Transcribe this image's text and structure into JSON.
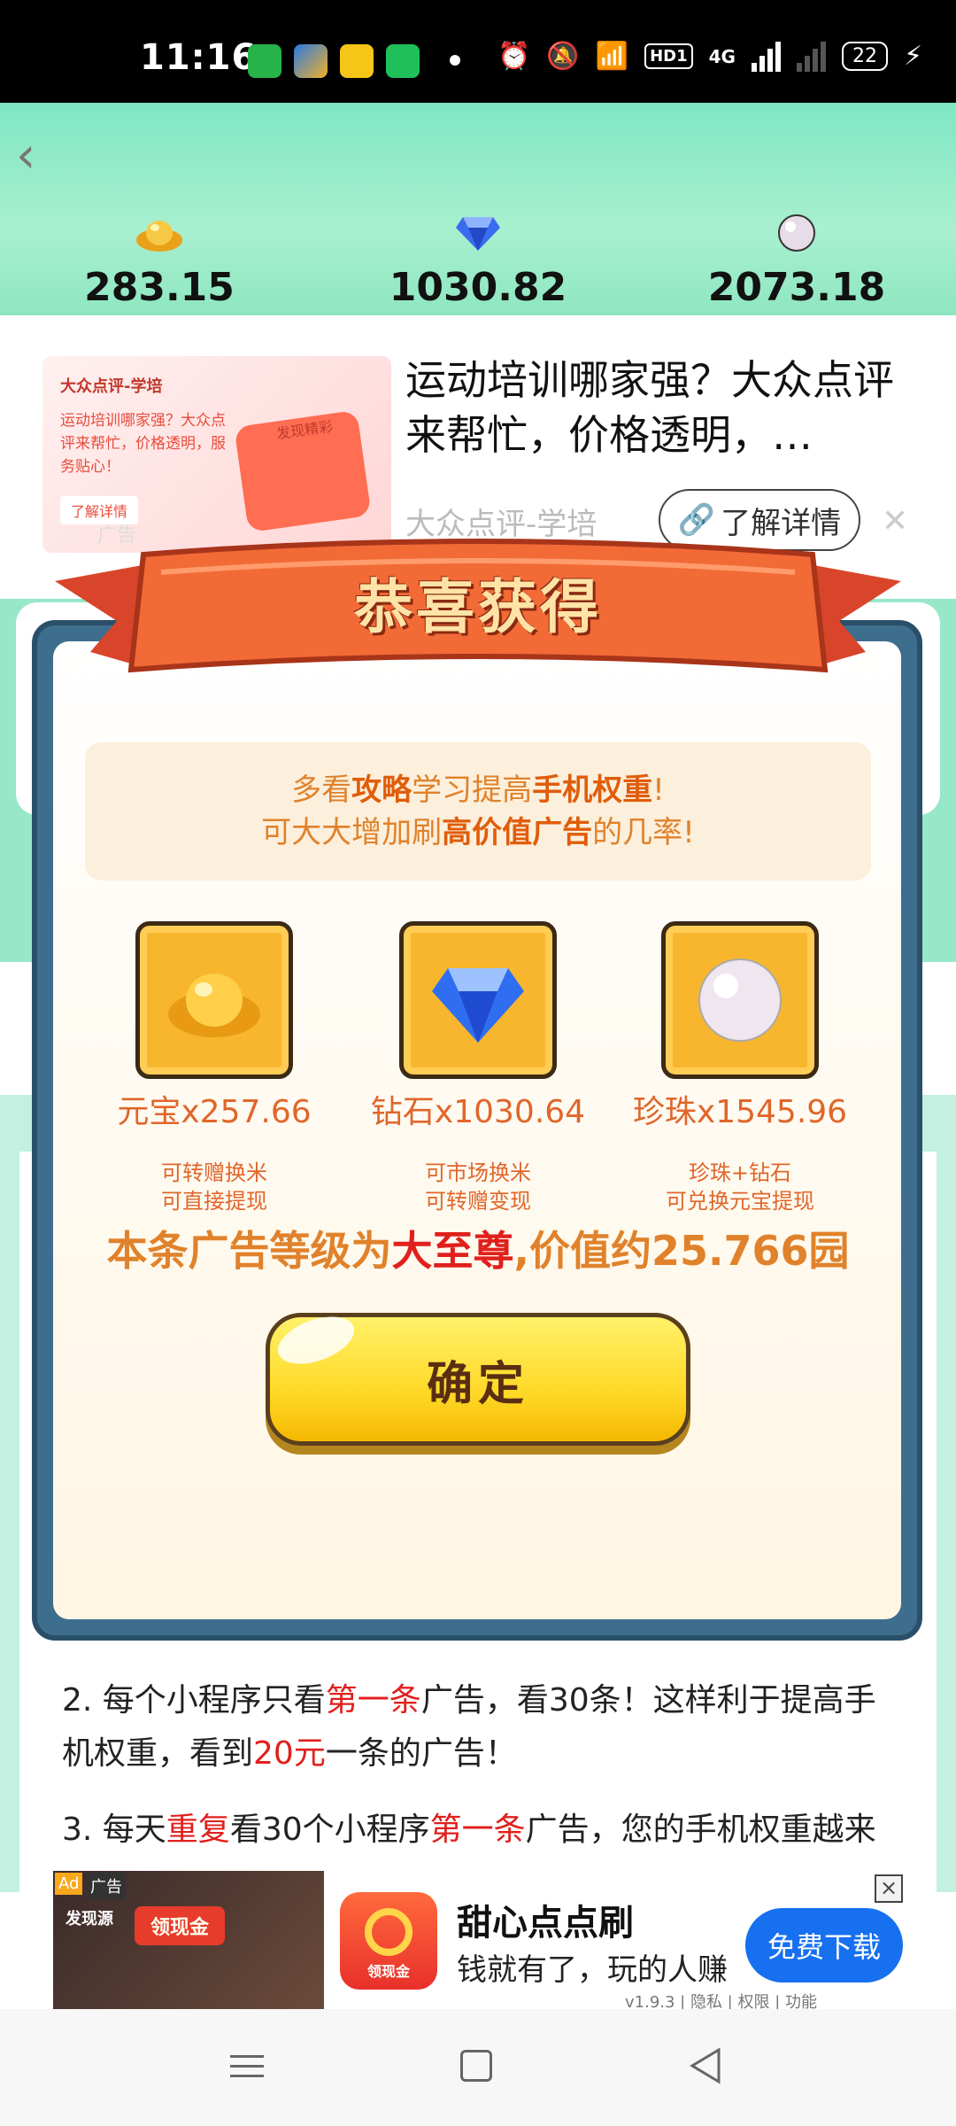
{
  "status_bar": {
    "time": "11:16",
    "network": "4G",
    "battery": "22",
    "hd_badge": "HD1"
  },
  "header": {
    "back_icon": "back-chevron-icon",
    "currencies": [
      {
        "icon": "gold-ingot-icon",
        "value": "283.15"
      },
      {
        "icon": "diamond-icon",
        "value": "1030.82"
      },
      {
        "icon": "pearl-icon",
        "value": "2073.18"
      }
    ]
  },
  "top_ad": {
    "thumb_title": "大众点评-学培",
    "thumb_desc": "运动培训哪家强？大众点评来帮忙，价格透明，服务贴心！",
    "thumb_button": "了解详情",
    "thumb_badge": "广告",
    "thumb_stamp": "发现精彩",
    "title": "运动培训哪家强？大众点评来帮忙，价格透明，…",
    "source": "大众点评-学培",
    "more_label": "了解详情"
  },
  "modal": {
    "banner_title": "恭喜获得",
    "tip_line1_parts": [
      "多看",
      "攻略",
      "学习提高",
      "手机权重",
      "!"
    ],
    "tip_line2_parts": [
      "可大大增加刷",
      "高价值广告",
      "的几率!"
    ],
    "rewards": [
      {
        "icon": "gold-ingot-icon",
        "amount": "元宝x257.66",
        "desc1": "可转赠换米",
        "desc2": "可直接提现"
      },
      {
        "icon": "diamond-icon",
        "amount": "钻石x1030.64",
        "desc1": "可市场换米",
        "desc2": "可转赠变现"
      },
      {
        "icon": "pearl-icon",
        "amount": "珍珠x1545.96",
        "desc1": "珍珠+钻石",
        "desc2": "可兑换元宝提现"
      }
    ],
    "level_parts": [
      "本条广告等级为",
      "大至尊",
      ",价值约25.766园"
    ],
    "confirm_label": "确定"
  },
  "article": {
    "line2_parts": [
      "2. 每个小程序只看",
      "第一条",
      "广告，看30条！这样利于提高手"
    ],
    "line2b_parts": [
      "机权重，看到",
      "20元",
      "一条的广告！"
    ],
    "line3_parts": [
      "3. 每天",
      "重复",
      "看30个小程序",
      "第一条",
      "广告，您的手机权重越来"
    ]
  },
  "bottom_ad": {
    "badge_ad": "Ad",
    "badge_label": "广告",
    "thumb_text": "发现源",
    "thumb_pill": "领现金",
    "app_name": "甜心点点刷",
    "app_icon_text": "领现金",
    "slogan": "钱就有了，玩的人赚",
    "download_label": "免费下载",
    "meta": "v1.9.3 | 隐私 | 权限 | 功能"
  },
  "colors": {
    "header_green": "#9eeecd",
    "accent_orange": "#e0822b",
    "emphasis_red": "#e0201c",
    "ribbon_red": "#ee5a2e",
    "modal_border": "#3e6e8e",
    "download_blue": "#1670f0"
  }
}
